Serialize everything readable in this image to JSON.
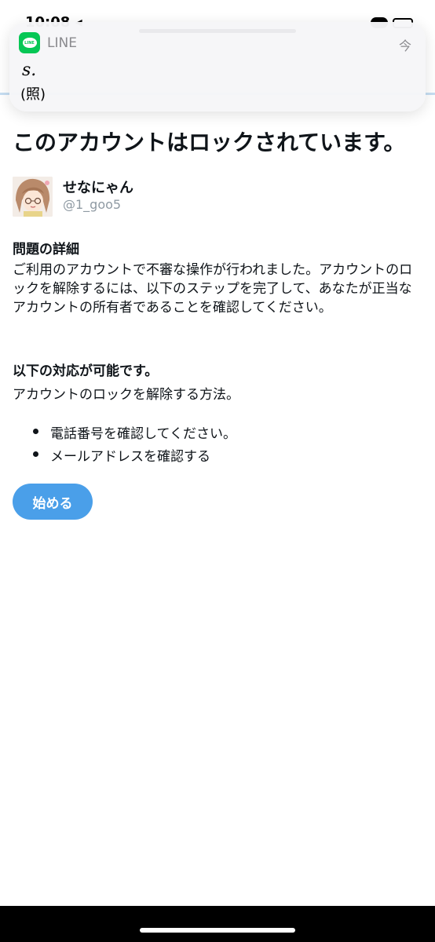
{
  "status_bar": {
    "time": "10:08 ◂"
  },
  "notification": {
    "app_name": "LINE",
    "app_icon": "line-app-icon",
    "app_icon_text": "LINE",
    "time": "今",
    "sender": "s.",
    "message": "(照)"
  },
  "page": {
    "title": "このアカウントはロックされています。",
    "profile": {
      "display_name": "せなにゃん",
      "handle": "@1_goo5"
    },
    "details": {
      "heading": "問題の詳細",
      "body": "ご利用のアカウントで不審な操作が行われました。アカウントのロックを解除するには、以下のステップを完了して、あなたが正当なアカウントの所有者であることを確認してください。"
    },
    "options": {
      "heading": "以下の対応が可能です。",
      "body": "アカウントのロックを解除する方法。",
      "methods": [
        "電話番号を確認してください。",
        "メールアドレスを確認する"
      ]
    },
    "start_button": "始める"
  },
  "colors": {
    "primary_button": "#4a9fe9",
    "line_green": "#06c755",
    "text": "#0f1419",
    "muted": "#8f9aa3"
  }
}
